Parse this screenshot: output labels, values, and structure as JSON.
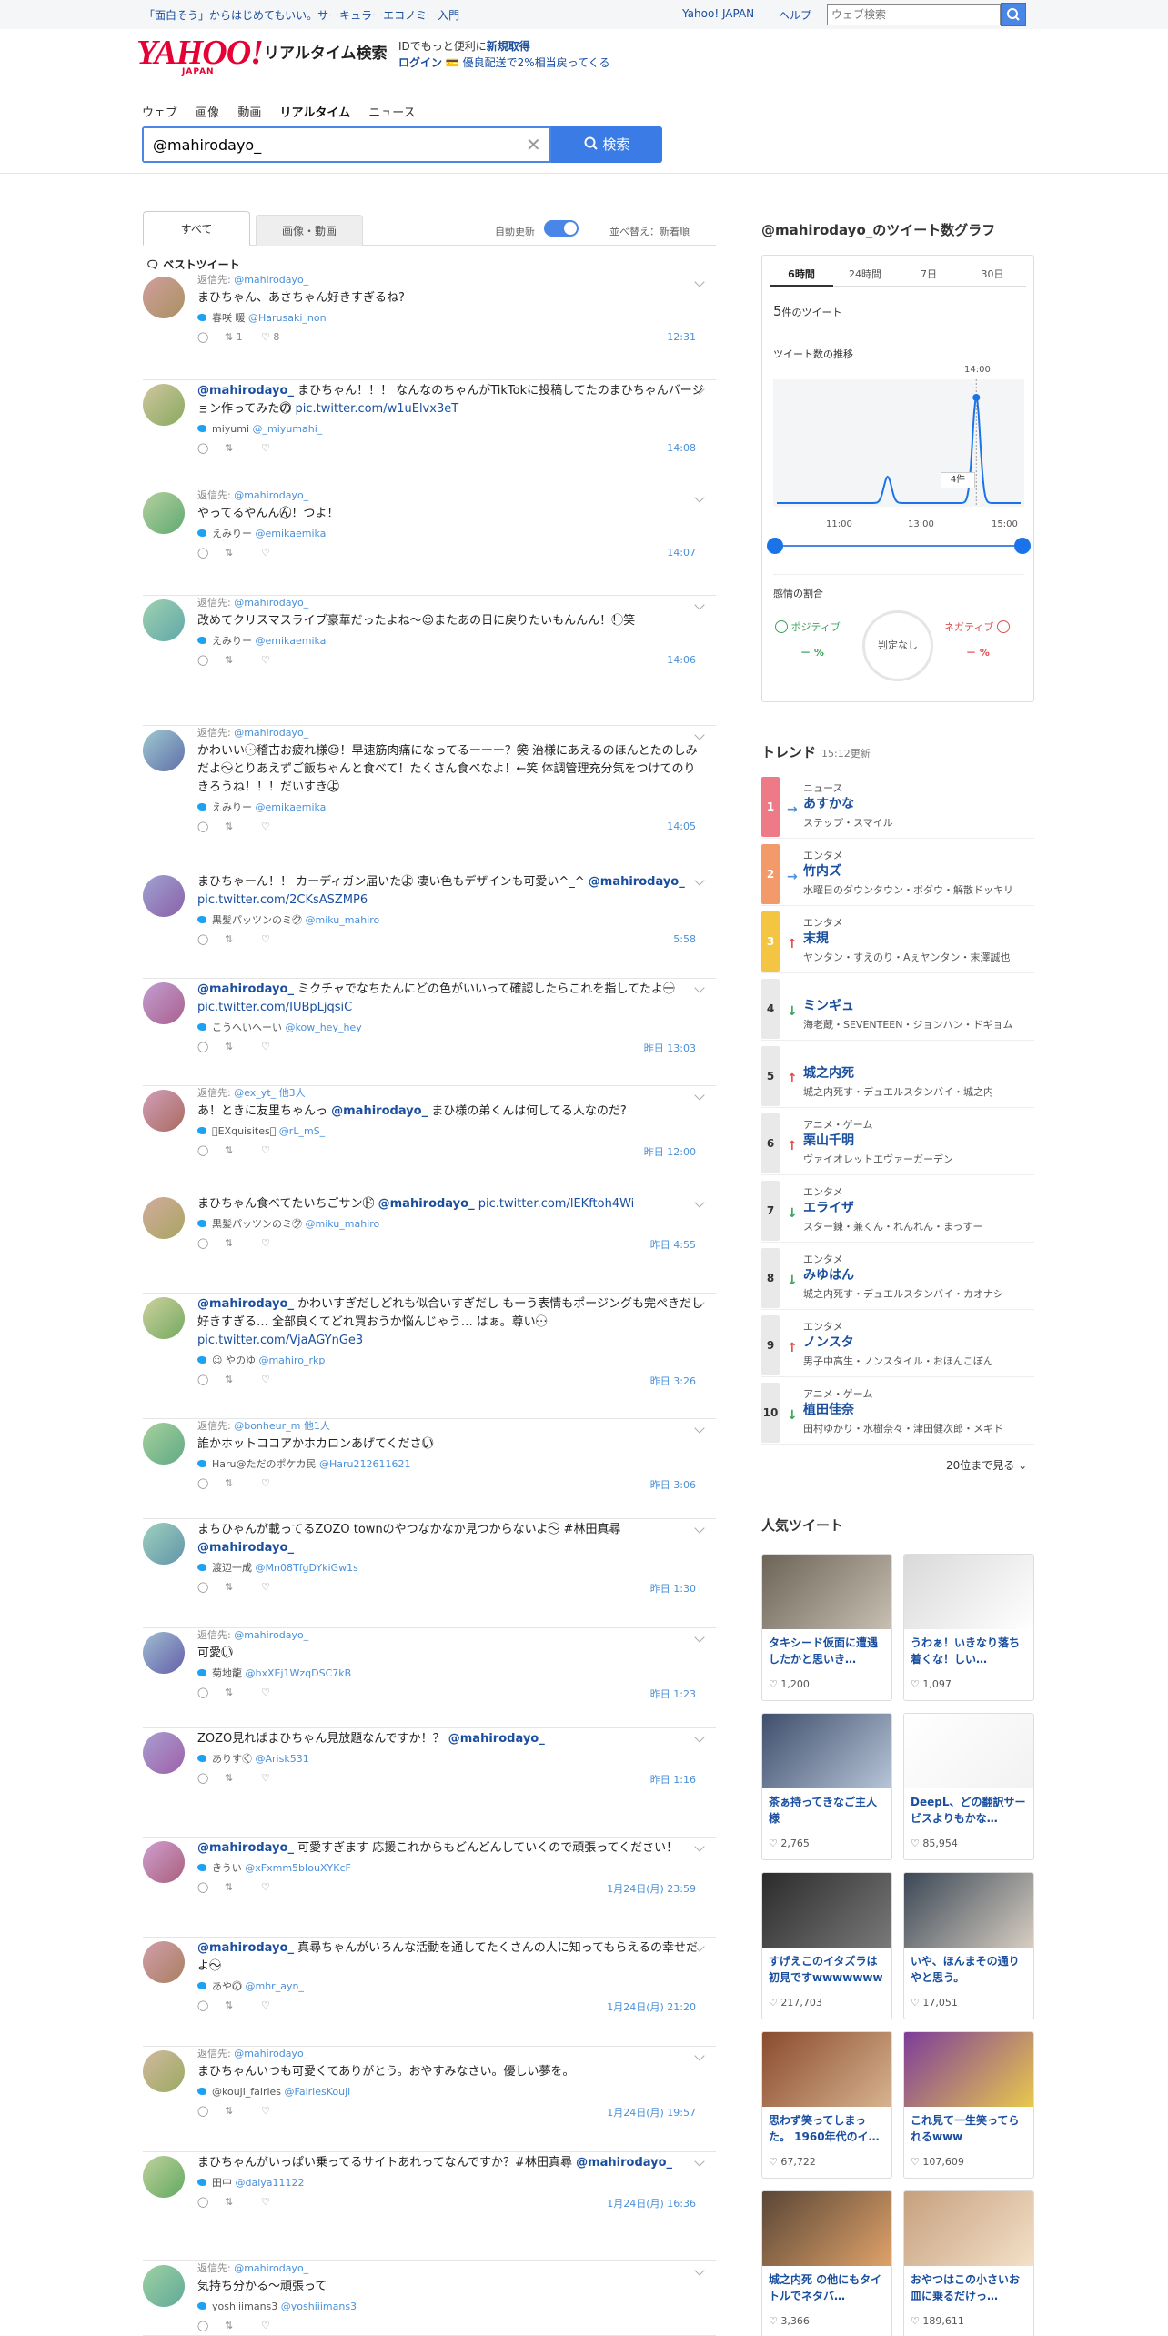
{
  "header": {
    "promo": "「面白そう」からはじめてもいい。サーキュラーエコノミー入門",
    "nav": [
      "Yahoo! JAPAN",
      "ヘルプ"
    ],
    "web_search_placeholder": "ウェブ検索",
    "logo": "YAHOO!",
    "logo_sub": "JAPAN",
    "product": "リアルタイム検索",
    "id_promo_line1": "IDでもっと便利に",
    "id_promo_signup": "新規取得",
    "id_promo_login": "ログイン",
    "id_promo_line2": "💳 優良配送で2%相当戻ってくる"
  },
  "search": {
    "tabs": [
      "ウェブ",
      "画像",
      "動画",
      "リアルタイム",
      "ニュース"
    ],
    "active_tab": "リアルタイム",
    "query": "@mahirodayo_",
    "button": "検索"
  },
  "results": {
    "tabs": [
      "すべて",
      "画像・動画"
    ],
    "auto_update": "自動更新",
    "sort": "並べ替え：新着順",
    "best_label": "ベストツイート",
    "tweets": [
      {
        "reply": "返信先:",
        "reply_to": "@mahirodayo_",
        "pre": "",
        "mention": "",
        "text": "まひちゃん、あさちゃん好きすぎるね?",
        "link": "",
        "author": "春咲 暖",
        "handle": "@Harusaki_non",
        "rt": "1",
        "like": "8",
        "time": "12:31"
      },
      {
        "reply": "",
        "reply_to": "",
        "pre": "",
        "mention": "@mahirodayo_",
        "text": " まひちゃん！！！ なんなのちゃんがTikTokに投稿してたのまひちゃんバージョン作ってみたの⃝⃝ ",
        "link": "pic.twitter.com/w1uElvx3eT",
        "author": "miyumi",
        "handle": "@_miyumahi_",
        "rt": "",
        "like": "",
        "time": "14:08"
      },
      {
        "reply": "返信先:",
        "reply_to": "@mahirodayo_",
        "pre": "",
        "mention": "",
        "text": "やってるやんんん⃝⃝！つよ！",
        "link": "",
        "author": "えみりー",
        "handle": "@emikaemika",
        "rt": "",
        "like": "",
        "time": "14:07"
      },
      {
        "reply": "返信先:",
        "reply_to": "@mahirodayo_",
        "pre": "",
        "mention": "",
        "text": "改めてクリスマスライブ豪華だったよね〜☺またあの日に戻りたいもんんん！！⃝笑",
        "link": "",
        "author": "えみりー",
        "handle": "@emikaemika",
        "rt": "",
        "like": "",
        "time": "14:06"
      },
      {
        "reply": "返信先:",
        "reply_to": "@mahirodayo_",
        "pre": "",
        "mention": "",
        "text": "かわいい…⃝稽古お疲れ様☺！早速筋肉痛になってるーーー？笑⃝ 治様にあえるのほんとたのしみだよ〜⃝とりあえずご飯ちゃんと食べて！たくさん食べなよ！←笑 体調管理充分気をつけてのりきろうね！！！だいすきよ⃝⃝",
        "link": "",
        "author": "えみりー",
        "handle": "@emikaemika",
        "rt": "",
        "like": "",
        "time": "14:05"
      },
      {
        "reply": "",
        "reply_to": "",
        "pre": "まひちゃーん！！ カーディガン届いたよ⃝ 凄い色もデザインも可愛い^_^ ",
        "mention": "@mahirodayo_",
        "text": " ",
        "link": "pic.twitter.com/2CKsASZMP6",
        "author": "黒髪パッツンのミク⃝",
        "handle": "@miku_mahiro",
        "rt": "",
        "like": "",
        "time": "5:58"
      },
      {
        "reply": "",
        "reply_to": "",
        "pre": "",
        "mention": "@mahirodayo_",
        "text": " ミクチャでなちたんにどの色がいいって確認したらこれを指してたよー⃝ ",
        "link": "pic.twitter.com/IUBpLjqsiC",
        "author": "こうへいへーい",
        "handle": "@kow_hey_hey",
        "rt": "",
        "like": "",
        "time": "昨日 13:03"
      },
      {
        "reply": "返信先:",
        "reply_to": "@ex_yt_ 他3人",
        "pre": "あ！ときに友里ちゃんっ ",
        "mention": "@mahirodayo_",
        "text": " まひ様の弟くんは何してる人なのだ?",
        "link": "",
        "author": "⃝EXquisites⃝",
        "handle": "@rL_mS_",
        "rt": "",
        "like": "",
        "time": "昨日 12:00"
      },
      {
        "reply": "",
        "reply_to": "",
        "pre": "まひちゃん食べてたいちごサンド⃝⃝ ",
        "mention": "@mahirodayo_",
        "text": " ",
        "link": "pic.twitter.com/lEKftoh4Wi",
        "author": "黒髪パッツンのミク⃝",
        "handle": "@miku_mahiro",
        "rt": "",
        "like": "",
        "time": "昨日 4:55"
      },
      {
        "reply": "",
        "reply_to": "",
        "pre": "",
        "mention": "@mahirodayo_",
        "text": " かわいすぎだしどれも似合いすぎだし もーう表情もポージングも完ぺきだし好きすぎる… 全部良くてどれ買おうか悩んじゃう… はぁ。尊い…⃝ ",
        "link": "pic.twitter.com/VjaAGYnGe3",
        "author": "☺ やのゆ",
        "handle": "@mahiro_rkp",
        "rt": "",
        "like": "",
        "time": "昨日 3:26"
      },
      {
        "reply": "返信先:",
        "reply_to": "@bonheur_m 他1人",
        "pre": "",
        "mention": "",
        "text": "誰かホットココアかホカロンあげてください⃝",
        "link": "",
        "author": "Haru@ただのポケカ民",
        "handle": "@Haru212611621",
        "rt": "",
        "like": "",
        "time": "昨日 3:06"
      },
      {
        "reply": "",
        "reply_to": "",
        "pre": "まちひゃんが載ってるZOZO townのやつなかなか見つからないよ〜⃝⃝ #林田真尋 ",
        "mention": "@mahirodayo_",
        "text": "",
        "link": "",
        "author": "渡辺一成",
        "handle": "@Mn08TfgDYkiGw1s",
        "rt": "",
        "like": "",
        "time": "昨日 1:30"
      },
      {
        "reply": "返信先:",
        "reply_to": "@mahirodayo_",
        "pre": "",
        "mention": "",
        "text": "可愛い⃝",
        "link": "",
        "author": "菊地龍",
        "handle": "@bxXEj1WzqDSC7kB",
        "rt": "",
        "like": "",
        "time": "昨日 1:23"
      },
      {
        "reply": "",
        "reply_to": "",
        "pre": "ZOZO見ればまひちゃん見放題なんですか！？ ",
        "mention": "@mahirodayo_",
        "text": "",
        "link": "",
        "author": "ありすく⃝",
        "handle": "@Arisk531",
        "rt": "",
        "like": "",
        "time": "昨日 1:16"
      },
      {
        "reply": "",
        "reply_to": "",
        "pre": "",
        "mention": "@mahirodayo_",
        "text": " 可愛すぎます 応援これからもどんどんしていくので頑張ってください！",
        "link": "",
        "author": "きうい",
        "handle": "@xFxmm5bIouXYKcF",
        "rt": "",
        "like": "",
        "time": "1月24日(月) 23:59"
      },
      {
        "reply": "",
        "reply_to": "",
        "pre": "",
        "mention": "@mahirodayo_",
        "text": " 真尋ちゃんがいろんな活動を通してたくさんの人に知ってもらえるの幸せだよ〜⃝",
        "link": "",
        "author": "あやの⃝",
        "handle": "@mhr_ayn_",
        "rt": "",
        "like": "",
        "time": "1月24日(月) 21:20"
      },
      {
        "reply": "返信先:",
        "reply_to": "@mahirodayo_",
        "pre": "",
        "mention": "",
        "text": "まひちゃんいつも可愛くてありがとう。おやすみなさい。優しい夢を。",
        "link": "",
        "author": "@kouji_fairies",
        "handle": "@FairiesKouji",
        "rt": "",
        "like": "",
        "time": "1月24日(月) 19:57"
      },
      {
        "reply": "",
        "reply_to": "",
        "pre": "まひちゃんがいっぱい乗ってるサイトあれってなんですか？#林田真尋 ",
        "mention": "@mahirodayo_",
        "text": "",
        "link": "",
        "author": "田中",
        "handle": "@daiya11122",
        "rt": "",
        "like": "",
        "time": "1月24日(月) 16:36"
      },
      {
        "reply": "返信先:",
        "reply_to": "@mahirodayo_",
        "pre": "",
        "mention": "",
        "text": "気持ち分かる〜頑張って",
        "link": "",
        "author": "yoshiiimans3",
        "handle": "@yoshiiimans3",
        "rt": "",
        "like": "",
        "time": ""
      }
    ]
  },
  "graph": {
    "title": "@mahirodayo_のツイート数グラフ",
    "tabs": [
      "6時間",
      "24時間",
      "7日",
      "30日"
    ],
    "active_tab": "6時間",
    "count_num": "5",
    "count_unit": "件のツイート",
    "trend_label": "ツイート数の推移",
    "peak_time": "14:00",
    "peak_count": "4件",
    "x_ticks": [
      "11:00",
      "13:00",
      "15:00"
    ],
    "sentiment_label": "感情の割合",
    "positive": "ポジティブ",
    "negative": "ネガティブ",
    "pos_val": "－ %",
    "neg_val": "－ %",
    "neutral": "判定なし"
  },
  "chart_data": {
    "type": "line",
    "x": [
      "09:30",
      "10:00",
      "10:30",
      "11:00",
      "11:30",
      "12:00",
      "12:30",
      "13:00",
      "13:30",
      "14:00",
      "14:30",
      "15:00"
    ],
    "values": [
      0,
      0,
      0,
      0,
      0,
      1,
      0,
      0,
      0,
      4,
      0,
      0
    ],
    "xlabel": "",
    "ylabel": "",
    "title": ""
  },
  "trends": {
    "title": "トレンド",
    "updated": "15:12更新",
    "items": [
      {
        "rank": "1",
        "dir": "→",
        "cat": "ニュース",
        "name": "あすかな",
        "sub": "ステップ・スマイル",
        "color": "#ee7a87"
      },
      {
        "rank": "2",
        "dir": "→",
        "cat": "エンタメ",
        "name": "竹内ズ",
        "sub": "水曜日のダウンタウン・ボダウ・解散ドッキリ",
        "color": "#f29a6a"
      },
      {
        "rank": "3",
        "dir": "↑",
        "cat": "エンタメ",
        "name": "末規",
        "sub": "ヤンタン・すえのり・Aぇヤンタン・末澤誠也",
        "color": "#f4c542"
      },
      {
        "rank": "4",
        "dir": "↓",
        "cat": "",
        "name": "ミンギュ",
        "sub": "海老蔵・SEVENTEEN・ジョンハン・ドギョム",
        "color": "#e9e9e9"
      },
      {
        "rank": "5",
        "dir": "↑",
        "cat": "",
        "name": "城之内死",
        "sub": "城之内死す・デュエルスタンバイ・城之内",
        "color": "#e9e9e9"
      },
      {
        "rank": "6",
        "dir": "↑",
        "cat": "アニメ・ゲーム",
        "name": "栗山千明",
        "sub": "ヴァイオレットエヴァーガーデン",
        "color": "#e9e9e9"
      },
      {
        "rank": "7",
        "dir": "↓",
        "cat": "エンタメ",
        "name": "エライザ",
        "sub": "スター錬・兼くん・れんれん・まっすー",
        "color": "#e9e9e9"
      },
      {
        "rank": "8",
        "dir": "↓",
        "cat": "エンタメ",
        "name": "みゆはん",
        "sub": "城之内死す・デュエルスタンバイ・カオナシ",
        "color": "#e9e9e9"
      },
      {
        "rank": "9",
        "dir": "↑",
        "cat": "エンタメ",
        "name": "ノンスタ",
        "sub": "男子中高生・ノンスタイル・おほんこぼん",
        "color": "#e9e9e9"
      },
      {
        "rank": "10",
        "dir": "↓",
        "cat": "アニメ・ゲーム",
        "name": "植田佳奈",
        "sub": "田村ゆかり・水樹奈々・津田健次郎・メギド",
        "color": "#e9e9e9"
      }
    ],
    "more": "20位まで見る"
  },
  "popular": {
    "title": "人気ツイート",
    "cards": [
      {
        "text": "タキシード仮面に遭遇したかと思いき…",
        "likes": "1,200",
        "c1": "#6d6458",
        "c2": "#c8c0b2"
      },
      {
        "text": "うわぁ！いきなり落ち着くな！しい…",
        "likes": "1,097",
        "c1": "#d9d9d9",
        "c2": "#ffffff"
      },
      {
        "text": "茶ぁ持ってきなご主人様",
        "likes": "2,765",
        "c1": "#3f4e6b",
        "c2": "#b7c6d8"
      },
      {
        "text": "DeepL、どの翻訳サービスよりもかな…",
        "likes": "85,954",
        "c1": "#ffffff",
        "c2": "#f2f2f2"
      },
      {
        "text": "すげえこのイタズラは初見ですwwwwwww",
        "likes": "217,703",
        "c1": "#2b2b2b",
        "c2": "#7a7a7a"
      },
      {
        "text": "いや、ほんまその通りやと思う。",
        "likes": "17,051",
        "c1": "#3b4756",
        "c2": "#d8cfc2"
      },
      {
        "text": "思わず笑ってしまった。 1960年代のイ…",
        "likes": "67,722",
        "c1": "#8a4b2d",
        "c2": "#d8b490"
      },
      {
        "text": "これ見て一生笑ってられるwww",
        "likes": "107,609",
        "c1": "#7e3c9a",
        "c2": "#e9c94d"
      },
      {
        "text": "城之内死 の他にもタイトルでネタバ…",
        "likes": "3,366",
        "c1": "#5a4636",
        "c2": "#e0a36a"
      },
      {
        "text": "おやつはこの小さいお皿に乗るだけっ…",
        "likes": "189,611",
        "c1": "#c7a07e",
        "c2": "#f3e1c9"
      }
    ]
  }
}
